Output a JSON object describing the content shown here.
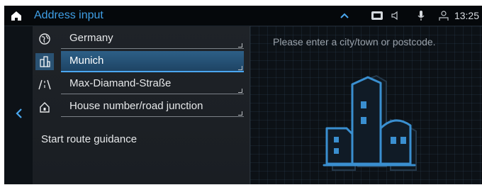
{
  "statusbar": {
    "title": "Address input",
    "time": "13:25",
    "icons": [
      "home-icon",
      "chevron-up-icon",
      "media-icon",
      "speaker-icon",
      "microphone-icon",
      "user-icon"
    ],
    "accent_color": "#3f9fe6"
  },
  "address_fields": [
    {
      "label": "Germany",
      "icon": "globe-icon",
      "selected": false
    },
    {
      "label": "Munich",
      "icon": "city-icon",
      "selected": true
    },
    {
      "label": "Max-Diamand-Straße",
      "icon": "road-icon",
      "selected": false
    },
    {
      "label": "House number/road junction",
      "icon": "house-icon",
      "selected": false
    }
  ],
  "actions": {
    "start_route": "Start route guidance"
  },
  "right_panel": {
    "hint": "Please enter a city/town or postcode.",
    "illustration": "city-buildings-icon"
  },
  "left_rail": {
    "back_icon": "chevron-left-icon"
  }
}
